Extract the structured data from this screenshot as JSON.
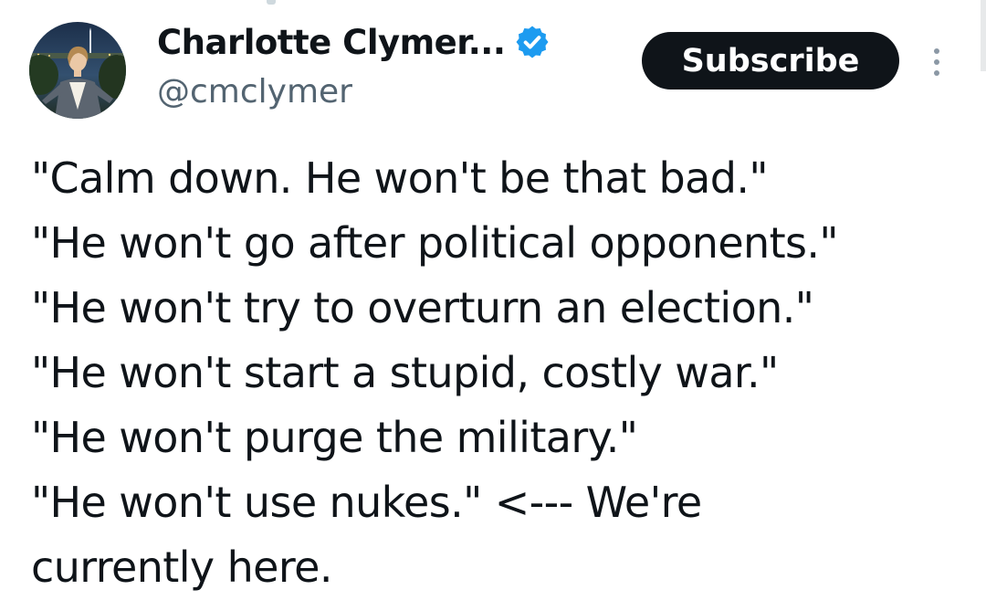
{
  "author": {
    "display_name": "Charlotte Clymer...",
    "handle": "@cmclymer",
    "avatar_icon": "profile-photo",
    "verified_icon": "verified-badge-icon",
    "verified_color": "#1d9bf0"
  },
  "actions": {
    "subscribe_label": "Subscribe",
    "more_icon": "more-vertical-icon"
  },
  "tweet": {
    "lines": [
      "\"Calm down. He won't be that bad.\"",
      "\"He won't go after political opponents.\"",
      "\"He won't try to overturn an election.\"",
      "\"He won't start a stupid, costly war.\"",
      "\"He won't purge the military.\"",
      "\"He won't use nukes.\" <--- We're",
      "currently here."
    ]
  },
  "colors": {
    "text": "#0f1419",
    "muted": "#536471",
    "button_bg": "#0f1419",
    "button_text": "#ffffff"
  }
}
